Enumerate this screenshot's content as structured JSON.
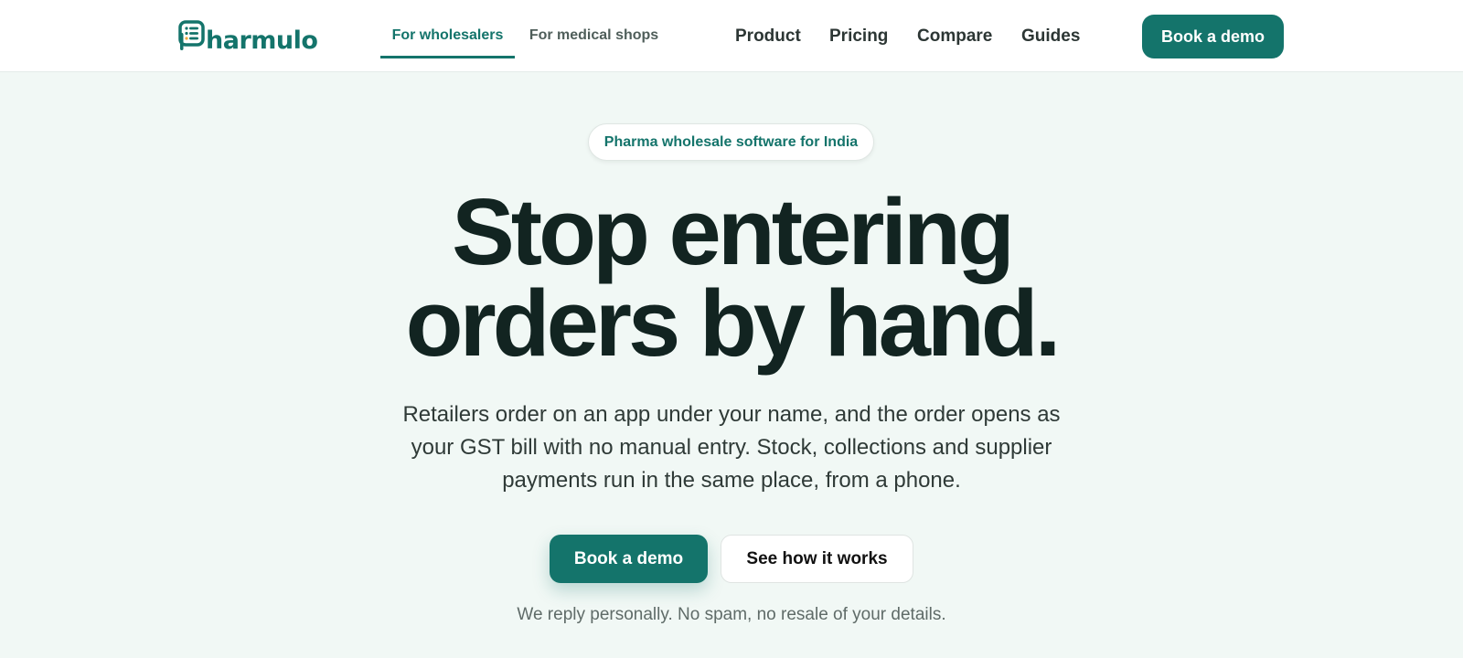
{
  "brand": {
    "logo_text": "harmulo",
    "logo_icon": "document-list-icon",
    "color": "#14746b"
  },
  "header": {
    "audience_tabs": [
      {
        "label": "For wholesalers",
        "active": true
      },
      {
        "label": "For medical shops",
        "active": false
      }
    ],
    "nav": [
      "Product",
      "Pricing",
      "Compare",
      "Guides"
    ],
    "cta_label": "Book a demo"
  },
  "hero": {
    "badge": "Pharma wholesale software for India",
    "headline_line1": "Stop entering",
    "headline_line2": "orders by hand.",
    "subtitle": "Retailers order on an app under your name, and the order opens as your GST bill with no manual entry. Stock, collections and supplier payments run in the same place, from a phone.",
    "primary_cta": "Book a demo",
    "secondary_cta": "See how it works",
    "note": "We reply personally. No spam, no resale of your details."
  },
  "colors": {
    "accent": "#14746b",
    "hero_background": "#f1f8f5",
    "heading": "#122421"
  }
}
